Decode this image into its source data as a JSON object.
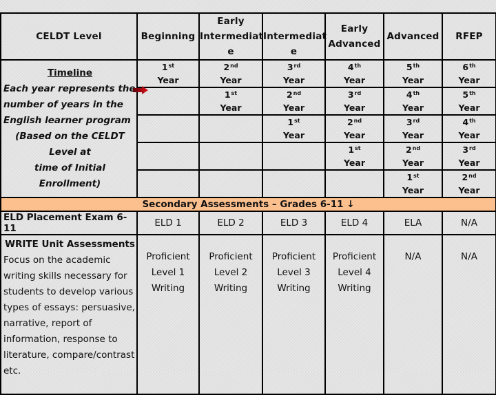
{
  "header": {
    "celdt_label": "CELDT Level",
    "levels": [
      {
        "line1": "Beginning",
        "line2": "",
        "line3": ""
      },
      {
        "line1": "Early",
        "line2": "Intermediat",
        "line3": "e"
      },
      {
        "line1": "",
        "line2": "Intermediat",
        "line3": "e"
      },
      {
        "line1": "Early",
        "line2": "Advanced",
        "line3": ""
      },
      {
        "line1": "Advanced",
        "line2": "",
        "line3": ""
      },
      {
        "line1": "RFEP",
        "line2": "",
        "line3": ""
      }
    ]
  },
  "timeline": {
    "title": "Timeline",
    "description_lines": [
      "Each year represents the",
      "number of years in the",
      "English learner program"
    ],
    "note_lines": [
      "(Based on the CELDT Level at",
      "time of Initial Enrollment)"
    ]
  },
  "year_rows": [
    [
      {
        "n": "1",
        "sup": "st",
        "word": "Year"
      },
      {
        "n": "2",
        "sup": "nd",
        "word": "Year"
      },
      {
        "n": "3",
        "sup": "rd",
        "word": "Year"
      },
      {
        "n": "4",
        "sup": "th",
        "word": "Year"
      },
      {
        "n": "5",
        "sup": "th",
        "word": "Year"
      },
      {
        "n": "6",
        "sup": "th",
        "word": "Year"
      }
    ],
    [
      null,
      {
        "n": "1",
        "sup": "st",
        "word": "Year"
      },
      {
        "n": "2",
        "sup": "nd",
        "word": "Year"
      },
      {
        "n": "3",
        "sup": "rd",
        "word": "Year"
      },
      {
        "n": "4",
        "sup": "th",
        "word": "Year"
      },
      {
        "n": "5",
        "sup": "th",
        "word": "Year"
      }
    ],
    [
      null,
      null,
      {
        "n": "1",
        "sup": "st",
        "word": "Year"
      },
      {
        "n": "2",
        "sup": "nd",
        "word": "Year"
      },
      {
        "n": "3",
        "sup": "rd",
        "word": "Year"
      },
      {
        "n": "4",
        "sup": "th",
        "word": "Year"
      }
    ],
    [
      null,
      null,
      null,
      {
        "n": "1",
        "sup": "st",
        "word": "Year"
      },
      {
        "n": "2",
        "sup": "nd",
        "word": "Year"
      },
      {
        "n": "3",
        "sup": "rd",
        "word": "Year"
      }
    ],
    [
      null,
      null,
      null,
      null,
      {
        "n": "1",
        "sup": "st",
        "word": "Year"
      },
      {
        "n": "2",
        "sup": "nd",
        "word": "Year"
      }
    ]
  ],
  "band": {
    "text": "Secondary Assessments – Grades 6-11",
    "arrow": "↓",
    "color": "#fcc08e"
  },
  "eld_row": {
    "label": "ELD Placement Exam 6-11",
    "values": [
      "ELD 1",
      "ELD 2",
      "ELD 3",
      "ELD 4",
      "ELA",
      "N/A"
    ]
  },
  "write_row": {
    "title": "WRITE Unit Assessments",
    "description_lines": [
      "Focus on the academic",
      "writing skills necessary for",
      "students to develop various",
      "types of essays:  persuasive,",
      "narrative, report of",
      "information, response to",
      "literature, compare/contrast",
      "etc."
    ],
    "values": [
      [
        "Proficient",
        "Level 1",
        "Writing"
      ],
      [
        "Proficient",
        "Level 2",
        "Writing"
      ],
      [
        "Proficient",
        "Level 3",
        "Writing"
      ],
      [
        "Proficient",
        "Level 4",
        "Writing"
      ],
      [
        "N/A"
      ],
      [
        "N/A"
      ]
    ]
  },
  "colors": {
    "arrow": "#c8101a",
    "border": "#000000"
  }
}
